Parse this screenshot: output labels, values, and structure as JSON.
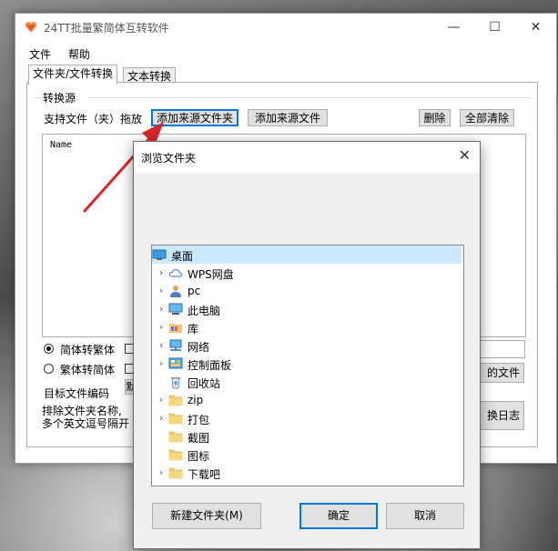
{
  "window": {
    "title": "24TT批量繁简体互转软件",
    "minimize": "—",
    "maximize": "☐",
    "close": "✕"
  },
  "menu": {
    "file": "文件",
    "help": "帮助"
  },
  "tabs": {
    "folder_file": "文件夹/文件转换",
    "text": "文本转换"
  },
  "source": {
    "group_label": "转换源",
    "support_label": "支持文件（夹）拖放",
    "add_folder_button": "添加来源文件夹",
    "add_file_button": "添加来源文件",
    "delete_button": "删除",
    "clear_all_button": "全部清除",
    "list_header_name": "Name"
  },
  "options": {
    "simp_to_trad": "简体转繁体",
    "trad_to_simp": "繁体转简体",
    "target_encoding": "目标文件编码",
    "exclude_label_1": "排除文件夹名称,",
    "exclude_label_2": "多个英文逗号隔开",
    "open_folder_button_fragment": "的文件夹",
    "log_button_fragment": "换日志",
    "default_fragment": "默"
  },
  "dialog": {
    "title": "浏览文件夹",
    "close": "✕",
    "tree": [
      {
        "label": "桌面",
        "icon": "desktop-icon",
        "expandable": false,
        "selected": true,
        "indent": 0
      },
      {
        "label": "WPS网盘",
        "icon": "cloud-icon",
        "expandable": true,
        "selected": false,
        "indent": 1
      },
      {
        "label": "pc",
        "icon": "user-icon",
        "expandable": true,
        "selected": false,
        "indent": 1
      },
      {
        "label": "此电脑",
        "icon": "computer-icon",
        "expandable": true,
        "selected": false,
        "indent": 1
      },
      {
        "label": "库",
        "icon": "library-icon",
        "expandable": true,
        "selected": false,
        "indent": 1
      },
      {
        "label": "网络",
        "icon": "network-icon",
        "expandable": true,
        "selected": false,
        "indent": 1
      },
      {
        "label": "控制面板",
        "icon": "control-panel-icon",
        "expandable": true,
        "selected": false,
        "indent": 1
      },
      {
        "label": "回收站",
        "icon": "recycle-bin-icon",
        "expandable": false,
        "selected": false,
        "indent": 1
      },
      {
        "label": "zip",
        "icon": "folder-icon",
        "expandable": true,
        "selected": false,
        "indent": 1
      },
      {
        "label": "打包",
        "icon": "folder-icon",
        "expandable": true,
        "selected": false,
        "indent": 1
      },
      {
        "label": "截图",
        "icon": "folder-icon",
        "expandable": false,
        "selected": false,
        "indent": 1
      },
      {
        "label": "图标",
        "icon": "folder-icon",
        "expandable": false,
        "selected": false,
        "indent": 1
      },
      {
        "label": "下载吧",
        "icon": "folder-icon",
        "expandable": true,
        "selected": false,
        "indent": 1
      }
    ],
    "new_folder_button": "新建文件夹(M)",
    "ok_button": "确定",
    "cancel_button": "取消"
  },
  "colors": {
    "accent": "#0078d7",
    "selection": "#cce8ff",
    "arrow": "#d9262a",
    "folder": "#f2c866"
  }
}
